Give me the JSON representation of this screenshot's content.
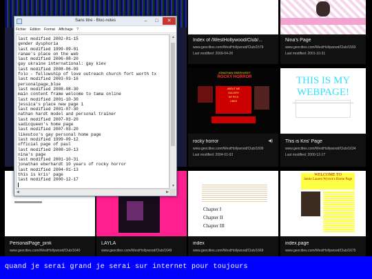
{
  "notepad": {
    "title": "Sans titre - Bloc-notes",
    "menu": [
      "Fichier",
      "Edition",
      "Format",
      "Affichage",
      "?"
    ],
    "minimize_symbol": "–",
    "maximize_symbol": "□",
    "close_symbol": "✕",
    "lines": [
      "last modified 2002-01-15",
      "gender dysphoria",
      "last modified 1999-09-01",
      "ranae's place on the web",
      "last modified 2006-08-20",
      "gay ukraine international: gay kiev",
      "last modified 2008-06-09",
      "folo - fellowship of love outreach church fort worth tx",
      "last modified 2003-03-16",
      "personalpage_blue",
      "last modified 2008-08-30",
      "main content frame welcome to tama online",
      "last modified 2001-10-30",
      "jessica's place new page 1",
      "last modified 2001-07-30",
      "nathan hardt model and personal trainer",
      "last modified 2007-03-20",
      "sadicqueen's home page",
      "last modified 2007-03-20",
      "likeutoo's gay personal home page",
      "last modified 1999-09-12",
      "official page of paul",
      "last modified 2008-10-13",
      "nina's page",
      "last modified 2001-10-31",
      "jonathan eberhardt 10 years of rocky horror",
      "last modified 2004-01-13",
      "this is kris' page",
      "last modified 2000-12-17"
    ]
  },
  "tiles": {
    "index_wh": {
      "title": "Index of /WestHollywood/Club/...",
      "url": "www.geocities.com/WestHollywood/Club/1579",
      "date": "Last modified: 2009-04-26"
    },
    "nina": {
      "title": "Nina's Page",
      "url": "www.geocities.com/WestHollywood/Club/1593",
      "date": "Last modified: 2001-10-31"
    },
    "rocky": {
      "title": "rocky horror",
      "url": "www.geocities.com/WestHollywood/Club/1609",
      "date": "Last modified: 2004-01-03",
      "banner_top": "JONATHAN EBERHARDT",
      "banner_main": "ROCKY HORROR",
      "red1": "ABOUT ME",
      "red2": "GALLERY",
      "red3": "MY PICS",
      "red4": "LINKS"
    },
    "kris": {
      "title": "This is Kris' Page",
      "url": "www.geocities.com/WestHollywood/Club/1634",
      "date": "Last modified: 2000-12-17",
      "heading_line1": "THIS IS MY",
      "heading_line2": "WEBPAGE!"
    },
    "personal_pink": {
      "title": "PersonalPage_pink",
      "url": "www.geocities.com/WestHollywood/Club/1640"
    },
    "layla": {
      "title": "LAYLA",
      "url": "www.geocities.com/WestHollywood/Club/1649"
    },
    "index2": {
      "title": "index",
      "url": "www.geocities.com/WestHollywood/Club/1669",
      "ch1": "Chapter I",
      "ch2": "Chapter II",
      "ch3": "Chapter III"
    },
    "index_page": {
      "title": "index.page",
      "url": "www.geocities.com/WestHollywood/Club/1675",
      "welcome": "WELCOME TO",
      "name": "Jamie Lauren Wyrick's Home Page"
    }
  },
  "caption": "quand je serai grand je serai sur internet pour toujours",
  "colors": {
    "caption_bg": "#0000ff",
    "rocky_red": "#cc0000",
    "kris_cyan": "#33e0ff",
    "layla_pink": "#ff1f8f"
  }
}
